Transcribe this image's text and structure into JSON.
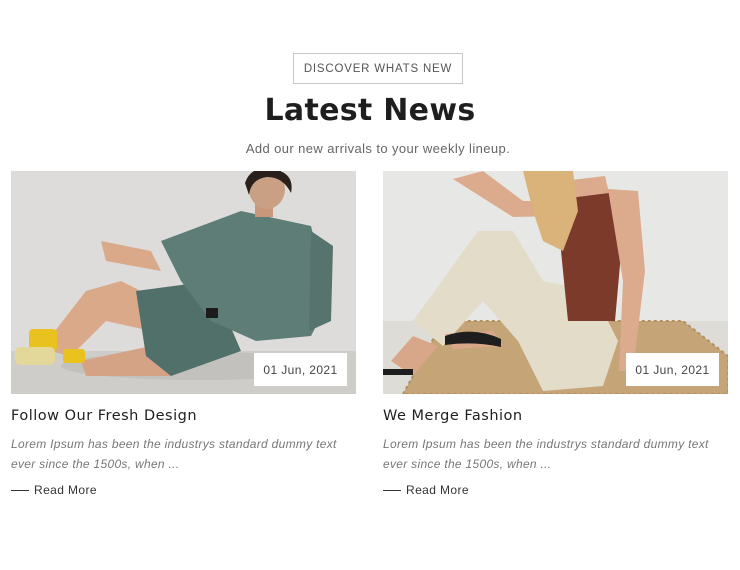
{
  "section": {
    "tag_label": "DISCOVER WHATS NEW",
    "title": "Latest News",
    "subtitle": "Add our new arrivals to your weekly lineup."
  },
  "posts": [
    {
      "date": "01 Jun, 2021",
      "title": "Follow Our Fresh Design",
      "excerpt": "Lorem Ipsum has been the industrys standard dummy text ever since the 1500s, when ...",
      "read_more": "Read More"
    },
    {
      "date": "01 Jun, 2021",
      "title": "We Merge Fashion",
      "excerpt": "Lorem Ipsum has been the industrys standard dummy text ever since the 1500s, when ...",
      "read_more": "Read More"
    }
  ]
}
